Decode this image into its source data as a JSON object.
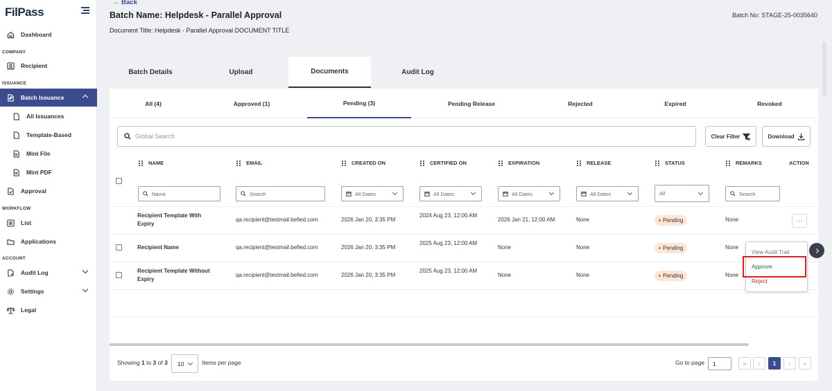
{
  "app": {
    "logo": "FilPass"
  },
  "sidebar": {
    "items": [
      {
        "label": "Dashboard"
      },
      {
        "section": "COMPANY"
      },
      {
        "label": "Recipient"
      },
      {
        "section": "ISSUANCE"
      },
      {
        "label": "Batch Issuance"
      },
      {
        "label": "All Issuances"
      },
      {
        "label": "Template-Based"
      },
      {
        "label": "Mint File"
      },
      {
        "label": "Mint PDF"
      },
      {
        "label": "Approval"
      },
      {
        "section": "WORKFLOW"
      },
      {
        "label": "List"
      },
      {
        "label": "Applications"
      },
      {
        "section": "ACCOUNT"
      },
      {
        "label": "Audit Log"
      },
      {
        "label": "Settings"
      },
      {
        "label": "Legal"
      }
    ]
  },
  "header": {
    "back": "Back",
    "batch_name": "Batch Name: Helpdesk - Parallel Approval",
    "document_title": "Document Title: Helpdesk - Parallel Approval DOCUMENT TITLE",
    "batch_no": "Batch No: STAGE-25-0035640"
  },
  "tabs": [
    "Batch Details",
    "Upload",
    "Documents",
    "Audit Log"
  ],
  "subtabs": [
    "All (4)",
    "Approved (1)",
    "Pending (3)",
    "Pending Release",
    "Rejected",
    "Expired",
    "Revoked"
  ],
  "search": {
    "placeholder": "Global Search",
    "clear_filter": "Clear Filter",
    "download": "Download"
  },
  "table": {
    "columns": [
      "NAME",
      "EMAIL",
      "CREATED ON",
      "CERTIFIED ON",
      "EXPIRATION",
      "RELEASE",
      "STATUS",
      "REMARKS",
      "ACTION"
    ],
    "filters": {
      "name": "Name",
      "email": "Search",
      "created": "All Dates",
      "certified": "All Dates",
      "expiration": "All Dates",
      "release": "All Dates",
      "status": "All",
      "remarks": "Search"
    },
    "rows": [
      {
        "name": "Recipient Template With Expiry",
        "email": "qa.recipient@testmail.befied.com",
        "created": "2026 Jan 20, 3:35 PM",
        "certified": "2024 Aug 23, 12:00 AM",
        "expiration": "2026 Jan 21, 12:00 AM",
        "release": "None",
        "status": "Pending",
        "remarks": "None"
      },
      {
        "name": "Recipient Name",
        "email": "qa.recipient@testmail.befied.com",
        "created": "2026 Jan 20, 3:35 PM",
        "certified": "2025 Aug 23, 12:00 AM",
        "expiration": "None",
        "release": "None",
        "status": "Pending",
        "remarks": "None"
      },
      {
        "name": "Recipient Template Without Expiry",
        "email": "qa.recipient@testmail.befied.com",
        "created": "2026 Jan 20, 3:35 PM",
        "certified": "2025 Aug 23, 12:00 AM",
        "expiration": "None",
        "release": "None",
        "status": "Pending",
        "remarks": "None"
      }
    ]
  },
  "pager": {
    "showing_prefix": "Showing ",
    "from": "1",
    "to_word": " to ",
    "to": "3",
    "of_word": " of ",
    "total": "3",
    "per_page": "10",
    "per_page_label": "Items per page",
    "goto_label": "Go to page",
    "goto_value": "1",
    "current": "1",
    "first": "«",
    "prev": "‹",
    "next": "›",
    "last": "»"
  },
  "action_menu": {
    "ellipsis": "···",
    "view_audit_trail": "View Audit Trail",
    "approve": "Approve",
    "reject": "Reject"
  },
  "colors": {
    "primary": "#3a4c8e",
    "approve": "#1f6b3a",
    "reject": "#c0272d",
    "pending_bg": "#fde6d6",
    "highlight": "#d62020"
  }
}
